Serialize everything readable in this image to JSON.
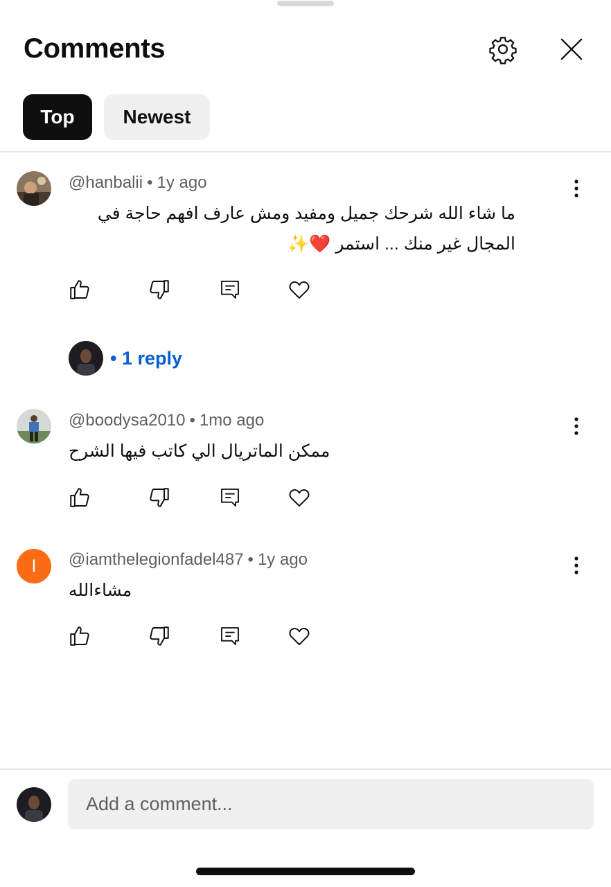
{
  "header": {
    "title": "Comments",
    "settings_icon": "gear-icon",
    "close_icon": "close-icon"
  },
  "tabs": [
    {
      "label": "Top",
      "selected": true
    },
    {
      "label": "Newest",
      "selected": false
    }
  ],
  "comments": [
    {
      "author": "@hanbalii",
      "time": "1y ago",
      "text_line1": "ما شاء الله شرحك جميل ومفيد ومش عارف افهم حاجة في",
      "text_line2": "المجال غير منك ... استمر ❤️✨",
      "avatar": "photo",
      "replies": {
        "label": "1 reply"
      }
    },
    {
      "author": "@boodysa2010",
      "time": "1mo ago",
      "text": "ممكن الماتريال الي كاتب فيها الشرح",
      "avatar": "photo"
    },
    {
      "author": "@iamthelegionfadel487",
      "time": "1y ago",
      "text": "مشاءالله",
      "avatar_letter": "I",
      "avatar_color": "#fb6d14"
    }
  ],
  "meta_separator": "•",
  "composer": {
    "placeholder": "Add a comment..."
  },
  "colors": {
    "accent": "#065fd4",
    "text": "#0f0f0f",
    "secondary": "#606060",
    "chip_selected": "#0f0f0f",
    "chip_bg": "#f0f0f0"
  }
}
